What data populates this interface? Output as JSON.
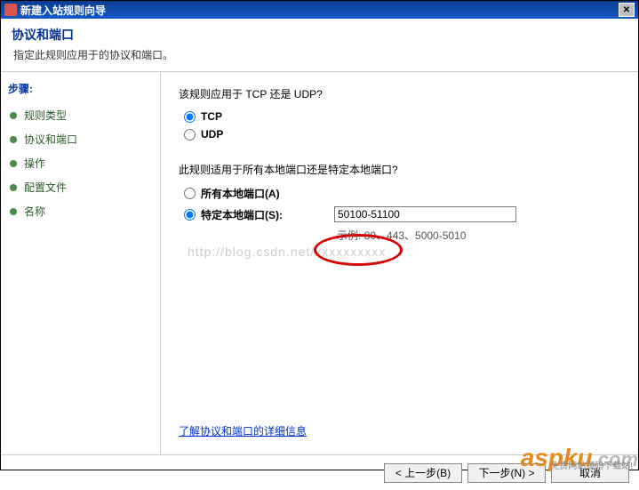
{
  "titlebar": {
    "title": "新建入站规则向导"
  },
  "header": {
    "title": "协议和端口",
    "desc": "指定此规则应用于的协议和端口。"
  },
  "sidebar": {
    "title": "步骤:",
    "items": [
      {
        "label": "规则类型"
      },
      {
        "label": "协议和端口"
      },
      {
        "label": "操作"
      },
      {
        "label": "配置文件"
      },
      {
        "label": "名称"
      }
    ]
  },
  "content": {
    "q1": "该规则应用于 TCP 还是 UDP?",
    "tcp": "TCP",
    "udp": "UDP",
    "q2": "此规则适用于所有本地端口还是特定本地端口?",
    "all_ports": "所有本地端口(A)",
    "specific_ports": "特定本地端口(S):",
    "port_value": "50100-51100",
    "example": "示例: 80、443、5000-5010",
    "watermark": "http://blog.csdn.net/xxxxxxxxxx",
    "link": "了解协议和端口的详细信息"
  },
  "footer": {
    "back": "< 上一步(B)",
    "next": "下一步(N) >",
    "cancel": "取消"
  },
  "brand": {
    "name": "aspku",
    "suffix": ".com",
    "sub": "免费网站源码下载站!"
  }
}
